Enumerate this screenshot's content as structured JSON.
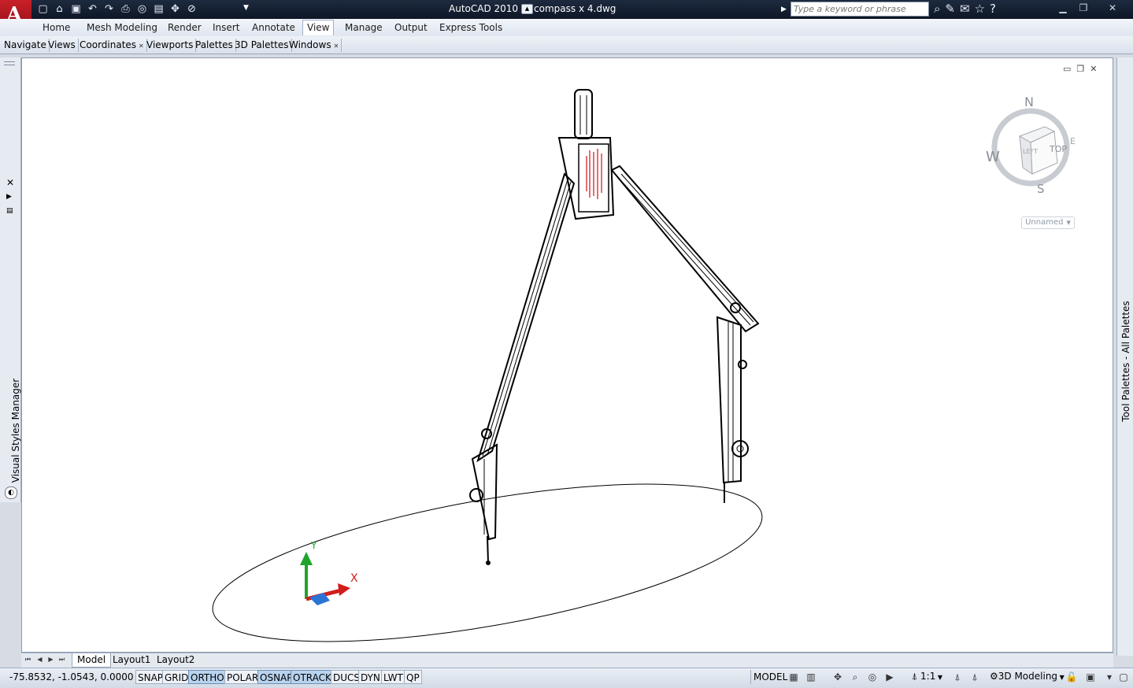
{
  "window": {
    "app_name": "AutoCAD 2010",
    "file_name": "compass x 4.dwg",
    "app_logo_letter": "A",
    "search_placeholder": "Type a keyword or phrase"
  },
  "quick_access": [
    {
      "name": "new-icon",
      "glyph": "▢"
    },
    {
      "name": "open-icon",
      "glyph": "⌂"
    },
    {
      "name": "save-icon",
      "glyph": "▣"
    },
    {
      "name": "undo-icon",
      "glyph": "↶"
    },
    {
      "name": "redo-icon",
      "glyph": "↷"
    },
    {
      "name": "plot-icon",
      "glyph": "⎙"
    },
    {
      "name": "publish-icon",
      "glyph": "◎"
    },
    {
      "name": "sheet-icon",
      "glyph": "▤"
    },
    {
      "name": "pan-icon",
      "glyph": "✥"
    },
    {
      "name": "lasso-icon",
      "glyph": "⊘"
    }
  ],
  "ribbon_tabs": [
    "Home",
    "Mesh Modeling",
    "Render",
    "Insert",
    "Annotate",
    "View",
    "Manage",
    "Output",
    "Express Tools"
  ],
  "active_ribbon_tab": "View",
  "panels": [
    {
      "label": "Navigate",
      "x": false
    },
    {
      "label": "Views",
      "x": false
    },
    {
      "label": "Coordinates",
      "x": true
    },
    {
      "label": "Viewports",
      "x": false
    },
    {
      "label": "Palettes",
      "x": false
    },
    {
      "label": "3D Palettes",
      "x": false
    },
    {
      "label": "Windows",
      "x": true
    }
  ],
  "left_palette_title": "Visual Styles Manager",
  "right_palette_title": "Tool Palettes - All Palettes",
  "viewcube": {
    "north": "N",
    "south": "S",
    "west": "W",
    "east": "E",
    "top_face": "TOP",
    "left_face": "LEFT",
    "view_name": "Unnamed"
  },
  "ucs": {
    "y_label": "Y",
    "x_label": "X"
  },
  "layout_tabs": [
    "Model",
    "Layout1",
    "Layout2"
  ],
  "active_layout_tab": "Model",
  "status": {
    "coordinates": "-75.8532, -1.0543, 0.0000",
    "toggles": [
      {
        "label": "SNAP",
        "on": false
      },
      {
        "label": "GRID",
        "on": false
      },
      {
        "label": "ORTHO",
        "on": true
      },
      {
        "label": "POLAR",
        "on": false
      },
      {
        "label": "OSNAP",
        "on": true
      },
      {
        "label": "OTRACK",
        "on": true
      },
      {
        "label": "DUCS",
        "on": false
      },
      {
        "label": "DYN",
        "on": false
      },
      {
        "label": "LWT",
        "on": false
      },
      {
        "label": "QP",
        "on": false
      }
    ],
    "space": "MODEL",
    "annotation_scale": "1:1",
    "workspace": "3D Modeling"
  },
  "colors": {
    "title_bg": "#0e1626",
    "logo_red": "#c8202a",
    "toggle_on": "#b9d3ee",
    "ucs_y": "#1fa52b",
    "ucs_x": "#d21d1d",
    "ucs_z": "#2a74d6",
    "label_red": "#d01010"
  }
}
